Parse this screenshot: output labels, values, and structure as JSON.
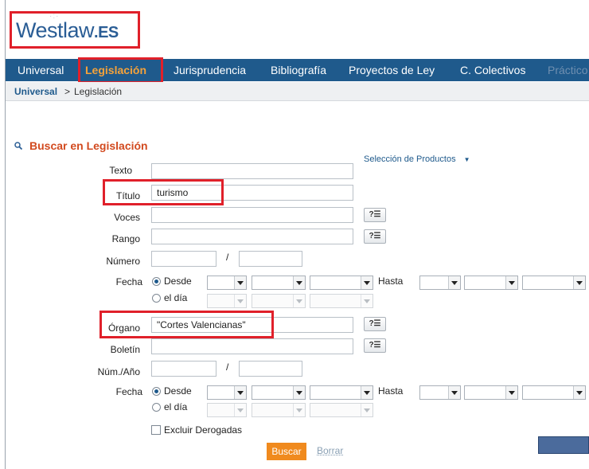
{
  "logo": {
    "main": "Westlaw",
    "suffix": ".ES"
  },
  "nav": {
    "items": [
      {
        "label": "Universal"
      },
      {
        "label": "Legislación"
      },
      {
        "label": "Jurisprudencia"
      },
      {
        "label": "Bibliografía"
      },
      {
        "label": "Proyectos de Ley"
      },
      {
        "label": "C. Colectivos"
      },
      {
        "label": "Práctico"
      }
    ],
    "active": "Legislación"
  },
  "breadcrumb": {
    "root": "Universal",
    "separator": ">",
    "current": "Legislación"
  },
  "search": {
    "title": "Buscar en Legislación",
    "product_selection": "Selección de Productos",
    "fields": {
      "texto": {
        "label": "Texto",
        "value": ""
      },
      "titulo": {
        "label": "Título",
        "value": "turismo"
      },
      "voces": {
        "label": "Voces",
        "value": ""
      },
      "rango": {
        "label": "Rango",
        "value": ""
      },
      "numero": {
        "label": "Número",
        "value": "",
        "value2": ""
      },
      "fecha1": {
        "label": "Fecha",
        "desde": "Desde",
        "el_dia": "el día",
        "hasta": "Hasta"
      },
      "organo": {
        "label": "Órgano",
        "value": "\"Cortes Valencianas\""
      },
      "boletin": {
        "label": "Boletín",
        "value": ""
      },
      "num_anio": {
        "label": "Núm./Año",
        "value": "",
        "value2": ""
      },
      "fecha2": {
        "label": "Fecha",
        "desde": "Desde",
        "el_dia": "el día",
        "hasta": "Hasta"
      }
    },
    "help_button": "?☰",
    "slash": "/",
    "excluir": "Excluir Derogadas",
    "buscar": "Buscar",
    "borrar": "Borrar"
  },
  "colors": {
    "nav_bg": "#1f5a8c",
    "active": "#f5a23a",
    "title": "#d24a1f",
    "highlight": "#e0202a",
    "button": "#f08a1e"
  }
}
